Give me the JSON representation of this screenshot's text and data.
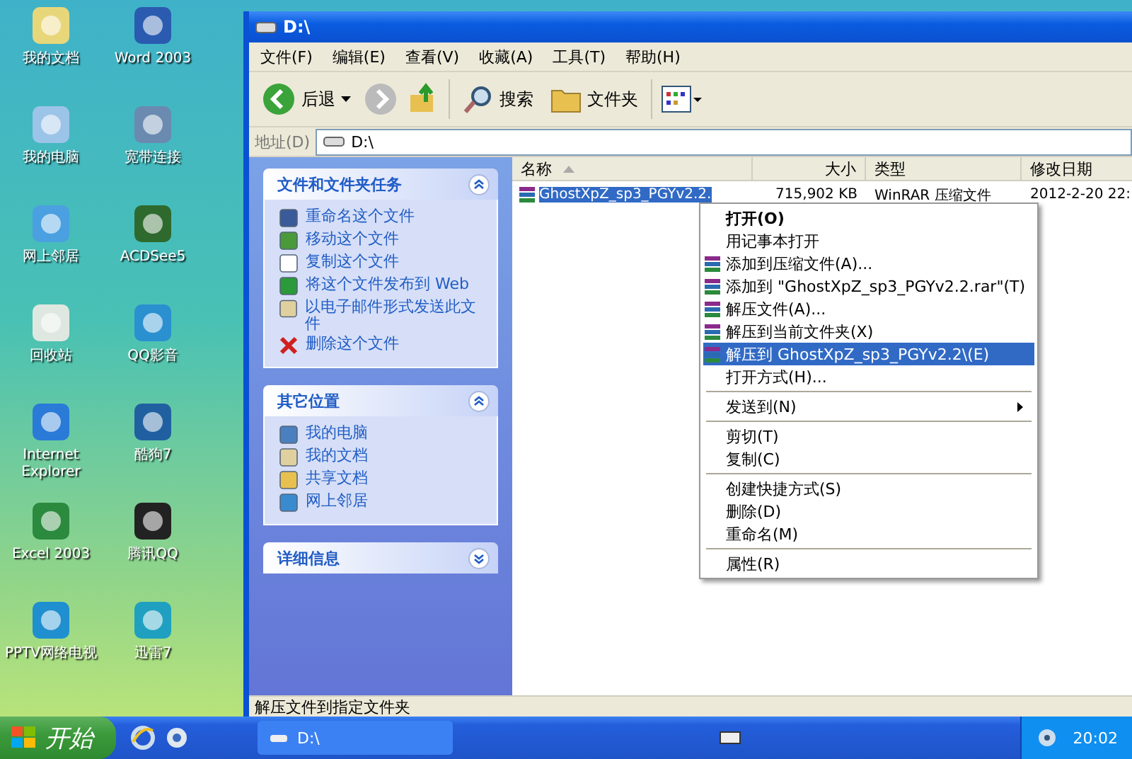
{
  "desktop_icons": [
    {
      "label": "我的文档"
    },
    {
      "label": "我的电脑"
    },
    {
      "label": "网上邻居"
    },
    {
      "label": "回收站"
    },
    {
      "label": "Internet Explorer"
    },
    {
      "label": "Excel 2003"
    },
    {
      "label": "PPTV网络电视"
    },
    {
      "label": "Word 2003"
    },
    {
      "label": "宽带连接"
    },
    {
      "label": "ACDSee5"
    },
    {
      "label": "QQ影音"
    },
    {
      "label": "酷狗7"
    },
    {
      "label": "腾讯QQ"
    },
    {
      "label": "迅雷7"
    }
  ],
  "window": {
    "title": "D:\\",
    "menu_bar": [
      "文件(F)",
      "编辑(E)",
      "查看(V)",
      "收藏(A)",
      "工具(T)",
      "帮助(H)"
    ],
    "toolbar": {
      "back": "后退",
      "search": "搜索",
      "folders": "文件夹"
    },
    "address": {
      "label": "地址(D)",
      "value": "D:\\"
    },
    "task_panels": [
      {
        "title": "文件和文件夹任务",
        "expanded": true,
        "items": [
          "重命名这个文件",
          "移动这个文件",
          "复制这个文件",
          "将这个文件发布到 Web",
          "以电子邮件形式发送此文件",
          "删除这个文件"
        ]
      },
      {
        "title": "其它位置",
        "expanded": true,
        "items": [
          "我的电脑",
          "我的文档",
          "共享文档",
          "网上邻居"
        ]
      },
      {
        "title": "详细信息",
        "expanded": false
      }
    ],
    "table": {
      "columns": [
        "名称",
        "大小",
        "类型",
        "修改日期"
      ],
      "rows": [
        {
          "name": "GhostXpZ_sp3_PGYv2.2.",
          "size": "715,902 KB",
          "type": "WinRAR 压缩文件",
          "date": "2012-2-20 22:",
          "selected": true
        }
      ]
    },
    "context_menu": {
      "items": [
        {
          "kind": "item",
          "label": "打开(O)",
          "default": true,
          "icon": false,
          "selected": false,
          "submenu": false
        },
        {
          "kind": "item",
          "label": "用记事本打开",
          "default": false,
          "icon": false,
          "selected": false,
          "submenu": false
        },
        {
          "kind": "item",
          "label": "添加到压缩文件(A)...",
          "default": false,
          "icon": true,
          "selected": false,
          "submenu": false
        },
        {
          "kind": "item",
          "label": "添加到 \"GhostXpZ_sp3_PGYv2.2.rar\"(T)",
          "default": false,
          "icon": true,
          "selected": false,
          "submenu": false
        },
        {
          "kind": "item",
          "label": "解压文件(A)...",
          "default": false,
          "icon": true,
          "selected": false,
          "submenu": false
        },
        {
          "kind": "item",
          "label": "解压到当前文件夹(X)",
          "default": false,
          "icon": true,
          "selected": false,
          "submenu": false
        },
        {
          "kind": "item",
          "label": "解压到 GhostXpZ_sp3_PGYv2.2\\(E)",
          "default": false,
          "icon": true,
          "selected": true,
          "submenu": false
        },
        {
          "kind": "item",
          "label": "打开方式(H)...",
          "default": false,
          "icon": false,
          "selected": false,
          "submenu": false
        },
        {
          "kind": "separator"
        },
        {
          "kind": "item",
          "label": "发送到(N)",
          "default": false,
          "icon": false,
          "selected": false,
          "submenu": true
        },
        {
          "kind": "separator"
        },
        {
          "kind": "item",
          "label": "剪切(T)",
          "default": false,
          "icon": false,
          "selected": false,
          "submenu": false
        },
        {
          "kind": "item",
          "label": "复制(C)",
          "default": false,
          "icon": false,
          "selected": false,
          "submenu": false
        },
        {
          "kind": "separator"
        },
        {
          "kind": "item",
          "label": "创建快捷方式(S)",
          "default": false,
          "icon": false,
          "selected": false,
          "submenu": false
        },
        {
          "kind": "item",
          "label": "删除(D)",
          "default": false,
          "icon": false,
          "selected": false,
          "submenu": false
        },
        {
          "kind": "item",
          "label": "重命名(M)",
          "default": false,
          "icon": false,
          "selected": false,
          "submenu": false
        },
        {
          "kind": "separator"
        },
        {
          "kind": "item",
          "label": "属性(R)",
          "default": false,
          "icon": false,
          "selected": false,
          "submenu": false
        }
      ]
    },
    "status_bar": "解压文件到指定文件夹"
  },
  "taskbar": {
    "start": "开始",
    "tasks": [
      {
        "label": "D:\\",
        "selected": false
      }
    ],
    "clock": "20:02"
  }
}
